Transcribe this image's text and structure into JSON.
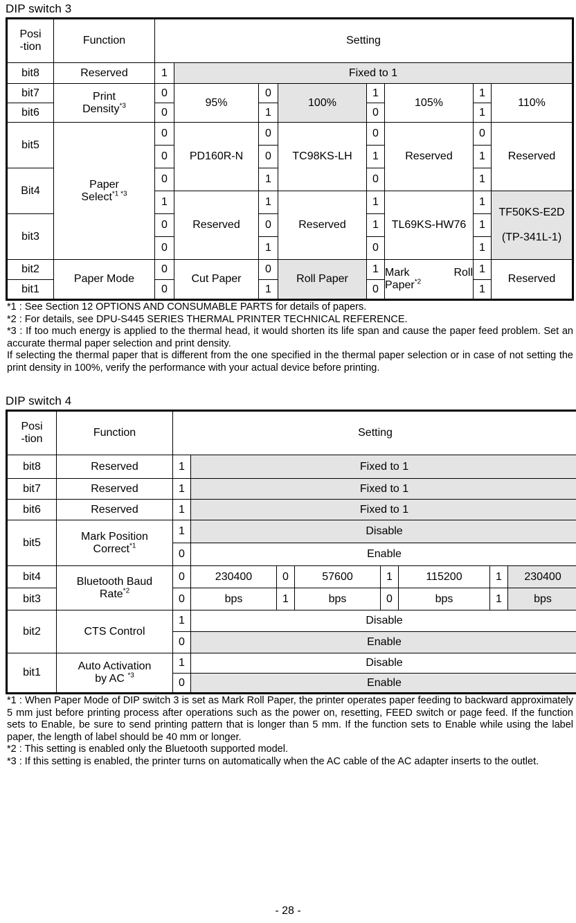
{
  "page": {
    "number_label": "- 28 -"
  },
  "dip3": {
    "title": "DIP switch 3",
    "headers": {
      "position": "Posi\n-tion",
      "position_line1": "Posi",
      "position_line2": "-tion",
      "function": "Function",
      "setting": "Setting"
    },
    "rows": {
      "bit8": {
        "position": "bit8",
        "function": "Reserved",
        "value": "1",
        "setting": "Fixed to 1",
        "shaded": true
      },
      "print_density": {
        "positions": [
          "bit7",
          "bit6"
        ],
        "function": "Print",
        "function_line2": "Density",
        "function_sup": "*3",
        "options": [
          {
            "bits": [
              "0",
              "0"
            ],
            "label": "95%",
            "shaded": false
          },
          {
            "bits": [
              "0",
              "1"
            ],
            "label": "100%",
            "shaded": true
          },
          {
            "bits": [
              "1",
              "0"
            ],
            "label": "105%",
            "shaded": false
          },
          {
            "bits": [
              "1",
              "1"
            ],
            "label": "110%",
            "shaded": false
          }
        ]
      },
      "paper_select": {
        "positions": [
          "bit5",
          "Bit4",
          "bit3"
        ],
        "function": "Paper",
        "function_line2": "Select",
        "function_sup": "*1 *3",
        "groups": [
          {
            "options": [
              {
                "bits": [
                  "0",
                  "0",
                  "0"
                ],
                "label": "PD160R-N",
                "shaded": false,
                "small": false
              },
              {
                "bits": [
                  "0",
                  "0",
                  "1"
                ],
                "label": "TC98KS-LH",
                "shaded": false,
                "small": false
              },
              {
                "bits": [
                  "0",
                  "1",
                  "0"
                ],
                "label": "Reserved",
                "shaded": false,
                "small": false
              },
              {
                "bits": [
                  "0",
                  "1",
                  "1"
                ],
                "label": "Reserved",
                "shaded": false,
                "small": false
              }
            ]
          },
          {
            "options": [
              {
                "bits": [
                  "1",
                  "0",
                  "0"
                ],
                "label": "Reserved",
                "shaded": false,
                "small": false
              },
              {
                "bits": [
                  "1",
                  "0",
                  "1"
                ],
                "label": "Reserved",
                "shaded": false,
                "small": false
              },
              {
                "bits": [
                  "1",
                  "1",
                  "0"
                ],
                "label": "TL69KS-HW76",
                "shaded": false,
                "small": true
              },
              {
                "bits": [
                  "1",
                  "1",
                  "1"
                ],
                "label_line1": "TF50KS-E2D",
                "label_line2": "(TP-341L-1)",
                "shaded": true,
                "small": true
              }
            ]
          }
        ]
      },
      "paper_mode": {
        "positions": [
          "bit2",
          "bit1"
        ],
        "function": "Paper Mode",
        "options": [
          {
            "bits": [
              "0",
              "0"
            ],
            "label": "Cut Paper",
            "shaded": false
          },
          {
            "bits": [
              "0",
              "1"
            ],
            "label": "Roll Paper",
            "shaded": true
          },
          {
            "bits": [
              "1",
              "0"
            ],
            "label_line1": "Mark",
            "label_line1b": "Roll",
            "label_line2": "Paper",
            "label_sup": "*2",
            "shaded": false
          },
          {
            "bits": [
              "1",
              "1"
            ],
            "label": "Reserved",
            "shaded": false
          }
        ]
      }
    },
    "notes": [
      "*1 : See Section 12 OPTIONS AND CONSUMABLE PARTS for details of papers.",
      "*2 : For details, see DPU-S445 SERIES THERMAL PRINTER TECHNICAL REFERENCE.",
      "*3 : If too much energy is applied to the thermal head, it would shorten its life span and cause the paper feed problem. Set an accurate thermal paper selection and print density.",
      "If selecting the thermal paper that is different from the one specified in the thermal paper selection or in case of not setting the print density in 100%, verify the performance with your actual device before printing."
    ]
  },
  "dip4": {
    "title": "DIP switch 4",
    "headers": {
      "position_line1": "Posi",
      "position_line2": "-tion",
      "function": "Function",
      "setting": "Setting"
    },
    "rows": {
      "bit8": {
        "position": "bit8",
        "function": "Reserved",
        "value": "1",
        "setting": "Fixed to 1",
        "shaded": true
      },
      "bit7": {
        "position": "bit7",
        "function": "Reserved",
        "value": "1",
        "setting": "Fixed to 1",
        "shaded": true
      },
      "bit6": {
        "position": "bit6",
        "function": "Reserved",
        "value": "1",
        "setting": "Fixed to 1",
        "shaded": true
      },
      "mark_position": {
        "position": "bit5",
        "function": "Mark Position",
        "function_line2": "Correct",
        "function_sup": "*1",
        "options": [
          {
            "value": "1",
            "label": "Disable",
            "shaded": true
          },
          {
            "value": "0",
            "label": "Enable",
            "shaded": false
          }
        ]
      },
      "bluetooth_baud": {
        "positions": [
          "bit4",
          "bit3"
        ],
        "function": "Bluetooth Baud",
        "function_line2": "Rate",
        "function_sup": "*2",
        "options": [
          {
            "bits": [
              "0",
              "0"
            ],
            "label_line1": "230400",
            "label_line2": "bps",
            "shaded": false
          },
          {
            "bits": [
              "0",
              "1"
            ],
            "label_line1": "57600",
            "label_line2": "bps",
            "shaded": false
          },
          {
            "bits": [
              "1",
              "0"
            ],
            "label_line1": "115200",
            "label_line2": "bps",
            "shaded": false
          },
          {
            "bits": [
              "1",
              "1"
            ],
            "label_line1": "230400",
            "label_line2": "bps",
            "shaded": true
          }
        ]
      },
      "cts_control": {
        "position": "bit2",
        "function": "CTS Control",
        "options": [
          {
            "value": "1",
            "label": "Disable",
            "shaded": false
          },
          {
            "value": "0",
            "label": "Enable",
            "shaded": true
          }
        ]
      },
      "auto_activation": {
        "position": "bit1",
        "function": "Auto Activation",
        "function_line2": "by AC",
        "function_sup": "*3",
        "options": [
          {
            "value": "1",
            "label": "Disable",
            "shaded": false
          },
          {
            "value": "0",
            "label": "Enable",
            "shaded": true
          }
        ]
      }
    },
    "notes": [
      "*1 : When Paper Mode of DIP switch 3 is set as Mark Roll Paper, the printer operates paper feeding to backward approximately 5 mm just before printing process after operations such as the power on, resetting, FEED switch or page feed.  If the function sets to Enable, be sure to send printing pattern that is longer than 5 mm.  If the function sets to Enable while using the label paper, the length of label should be 40 mm or longer.",
      "*2 : This setting is enabled only the Bluetooth supported model.",
      "*3 : If this setting is enabled, the printer turns on automatically when the AC cable of the AC adapter inserts to the outlet."
    ]
  },
  "colors": {
    "shade": "#e4e4e4",
    "border": "#000000",
    "text": "#000000"
  }
}
